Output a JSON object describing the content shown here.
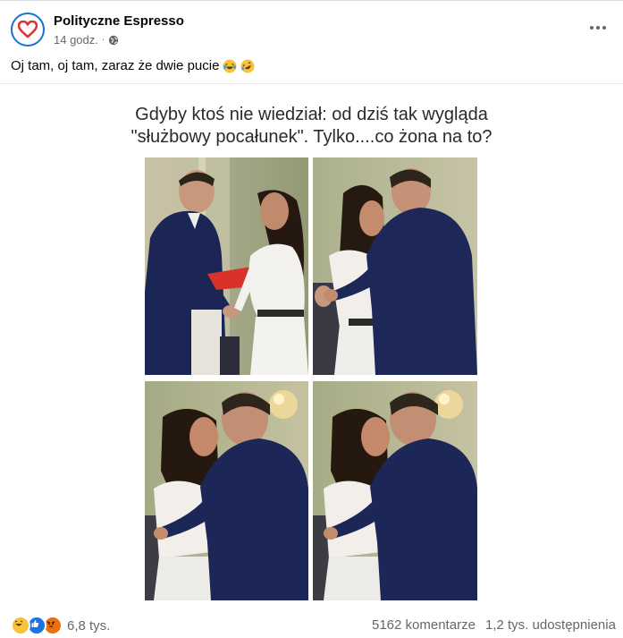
{
  "post": {
    "page_name": "Polityczne Espresso",
    "time": "14 godz.",
    "separator": "·",
    "caption": "Oj tam, oj tam, zaraz że dwie pucie",
    "caption_emojis": [
      "laughing-tears-emoji",
      "rolling-laughing-emoji"
    ],
    "brand_color": "#1d6fd6",
    "heart_color": "#e0322f"
  },
  "meme": {
    "line1": "Gdyby ktoś nie wiedział: od dziś tak wygląda",
    "line2": "\"służbowy pocałunek\". Tylko....co żona na to?",
    "photos": [
      "photo-handshake-ceremony",
      "photo-embrace",
      "photo-kiss-closeup",
      "photo-kiss-closeup-2"
    ]
  },
  "stats": {
    "reaction_icons": [
      "haha-icon",
      "like-icon",
      "angry-icon"
    ],
    "reaction_count": "6,8 tys.",
    "comments": "5162 komentarze",
    "shares": "1,2 tys. udostępnienia"
  }
}
